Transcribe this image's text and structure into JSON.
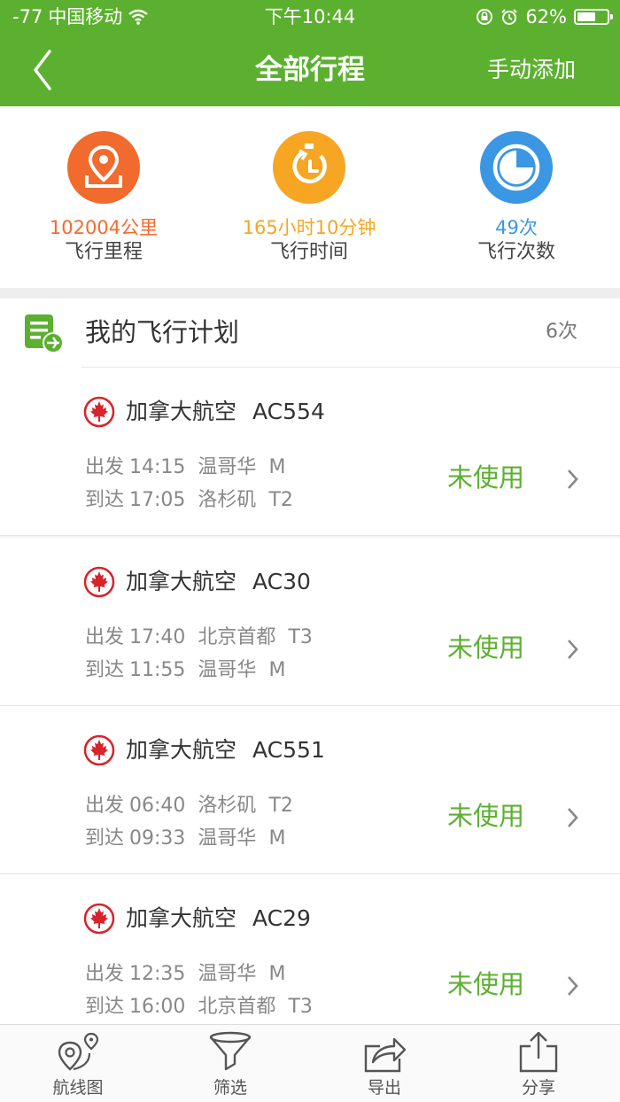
{
  "status_bar": {
    "signal": "-77",
    "carrier": "中国移动",
    "time": "下午10:44",
    "battery": "62%",
    "battery_level": 0.62
  },
  "nav": {
    "title": "全部行程",
    "action": "手动添加"
  },
  "stats": [
    {
      "value": "102004公里",
      "label": "飞行里程",
      "color": "#f26b2e",
      "icon": "location-pin-icon"
    },
    {
      "value": "165小时10分钟",
      "label": "飞行时间",
      "color": "#f6a623",
      "icon": "stopwatch-icon"
    },
    {
      "value": "49次",
      "label": "飞行次数",
      "color": "#3b97e3",
      "icon": "pie-chart-icon"
    }
  ],
  "section": {
    "title": "我的飞行计划",
    "count": "6次"
  },
  "flights": [
    {
      "airline": "加拿大航空",
      "flight_no": "AC554",
      "dep_label": "出发",
      "dep_time": "14:15",
      "dep_city": "温哥华",
      "dep_term": "M",
      "arr_label": "到达",
      "arr_time": "17:05",
      "arr_city": "洛杉矶",
      "arr_term": "T2",
      "status": "未使用"
    },
    {
      "airline": "加拿大航空",
      "flight_no": "AC30",
      "dep_label": "出发",
      "dep_time": "17:40",
      "dep_city": "北京首都",
      "dep_term": "T3",
      "arr_label": "到达",
      "arr_time": "11:55",
      "arr_city": "温哥华",
      "arr_term": "M",
      "status": "未使用"
    },
    {
      "airline": "加拿大航空",
      "flight_no": "AC551",
      "dep_label": "出发",
      "dep_time": "06:40",
      "dep_city": "洛杉矶",
      "dep_term": "T2",
      "arr_label": "到达",
      "arr_time": "09:33",
      "arr_city": "温哥华",
      "arr_term": "M",
      "status": "未使用"
    },
    {
      "airline": "加拿大航空",
      "flight_no": "AC29",
      "dep_label": "出发",
      "dep_time": "12:35",
      "dep_city": "温哥华",
      "dep_term": "M",
      "arr_label": "到达",
      "arr_time": "16:00",
      "arr_city": "北京首都",
      "arr_term": "T3",
      "status": "未使用"
    }
  ],
  "tabs": [
    {
      "label": "航线图",
      "icon": "route-map-icon"
    },
    {
      "label": "筛选",
      "icon": "funnel-icon"
    },
    {
      "label": "导出",
      "icon": "export-icon"
    },
    {
      "label": "分享",
      "icon": "share-icon"
    }
  ],
  "colors": {
    "brand_green": "#5cb030",
    "airline_red": "#d8232a"
  }
}
